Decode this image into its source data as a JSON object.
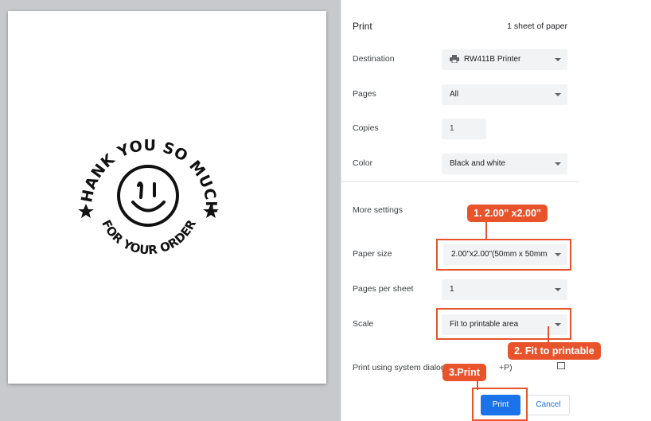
{
  "preview": {
    "stamp_top_text": "THANK YOU SO MUCH",
    "stamp_bottom_text": "FOR YOUR ORDER"
  },
  "panel": {
    "title": "Print",
    "sheet_count": "1 sheet of paper",
    "destination": {
      "label": "Destination",
      "value": "RW411B Printer"
    },
    "pages": {
      "label": "Pages",
      "value": "All"
    },
    "copies": {
      "label": "Copies",
      "value": "1"
    },
    "color": {
      "label": "Color",
      "value": "Black and white"
    },
    "more_settings": "More settings",
    "paper_size": {
      "label": "Paper size",
      "value": "2.00\"x2.00\"(50mm x 50mm"
    },
    "pages_per_sheet": {
      "label": "Pages per sheet",
      "value": "1"
    },
    "scale": {
      "label": "Scale",
      "value": "Fit to printable area"
    },
    "system_dialog": "Print using system dialog",
    "system_dialog_shortcut": "+P)",
    "print_button": "Print",
    "cancel_button": "Cancel"
  },
  "annotations": {
    "step1": "1. 2.00\" x2.00\"",
    "step2": "2. Fit to printable",
    "step3": "3.Print",
    "accent": "#e8532b"
  }
}
